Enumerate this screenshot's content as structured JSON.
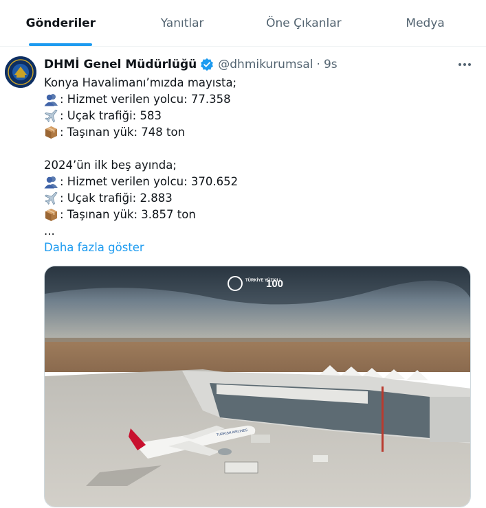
{
  "tabs": [
    {
      "label": "Gönderiler",
      "active": true
    },
    {
      "label": "Yanıtlar",
      "active": false
    },
    {
      "label": "Öne Çıkanlar",
      "active": false
    },
    {
      "label": "Medya",
      "active": false
    }
  ],
  "post": {
    "author": {
      "display_name": "DHMİ Genel Müdürlüğü",
      "handle": "@dhmikurumsal",
      "separator": "·",
      "time": "9s",
      "verified": true
    },
    "lines": {
      "l1": "Konya Havalimanı’mızda mayısta;",
      "l2": ": Hizmet verilen yolcu: 77.358",
      "l3": ": Uçak trafiği: 583",
      "l4": ": Taşınan yük: 748 ton",
      "l5": "2024’ün ilk beş ayında;",
      "l6": ": Hizmet verilen yolcu: 370.652",
      "l7": ": Uçak trafiği: 2.883",
      "l8": ": Taşınan yük: 3.857 ton",
      "l9": "..."
    },
    "show_more": "Daha fazla göster",
    "media": {
      "badge_left": "TÜRKİYE YÜZYILI",
      "badge_right": "100",
      "airline_text": "TURKISH AIRLINES"
    }
  },
  "icons": {
    "passenger": "people-icon",
    "plane": "airplane-icon",
    "cargo": "package-icon",
    "more": "more-horizontal-icon",
    "verified": "verified-badge-icon"
  },
  "colors": {
    "accent": "#1d9bf0",
    "text": "#0f1419",
    "muted": "#536471"
  }
}
